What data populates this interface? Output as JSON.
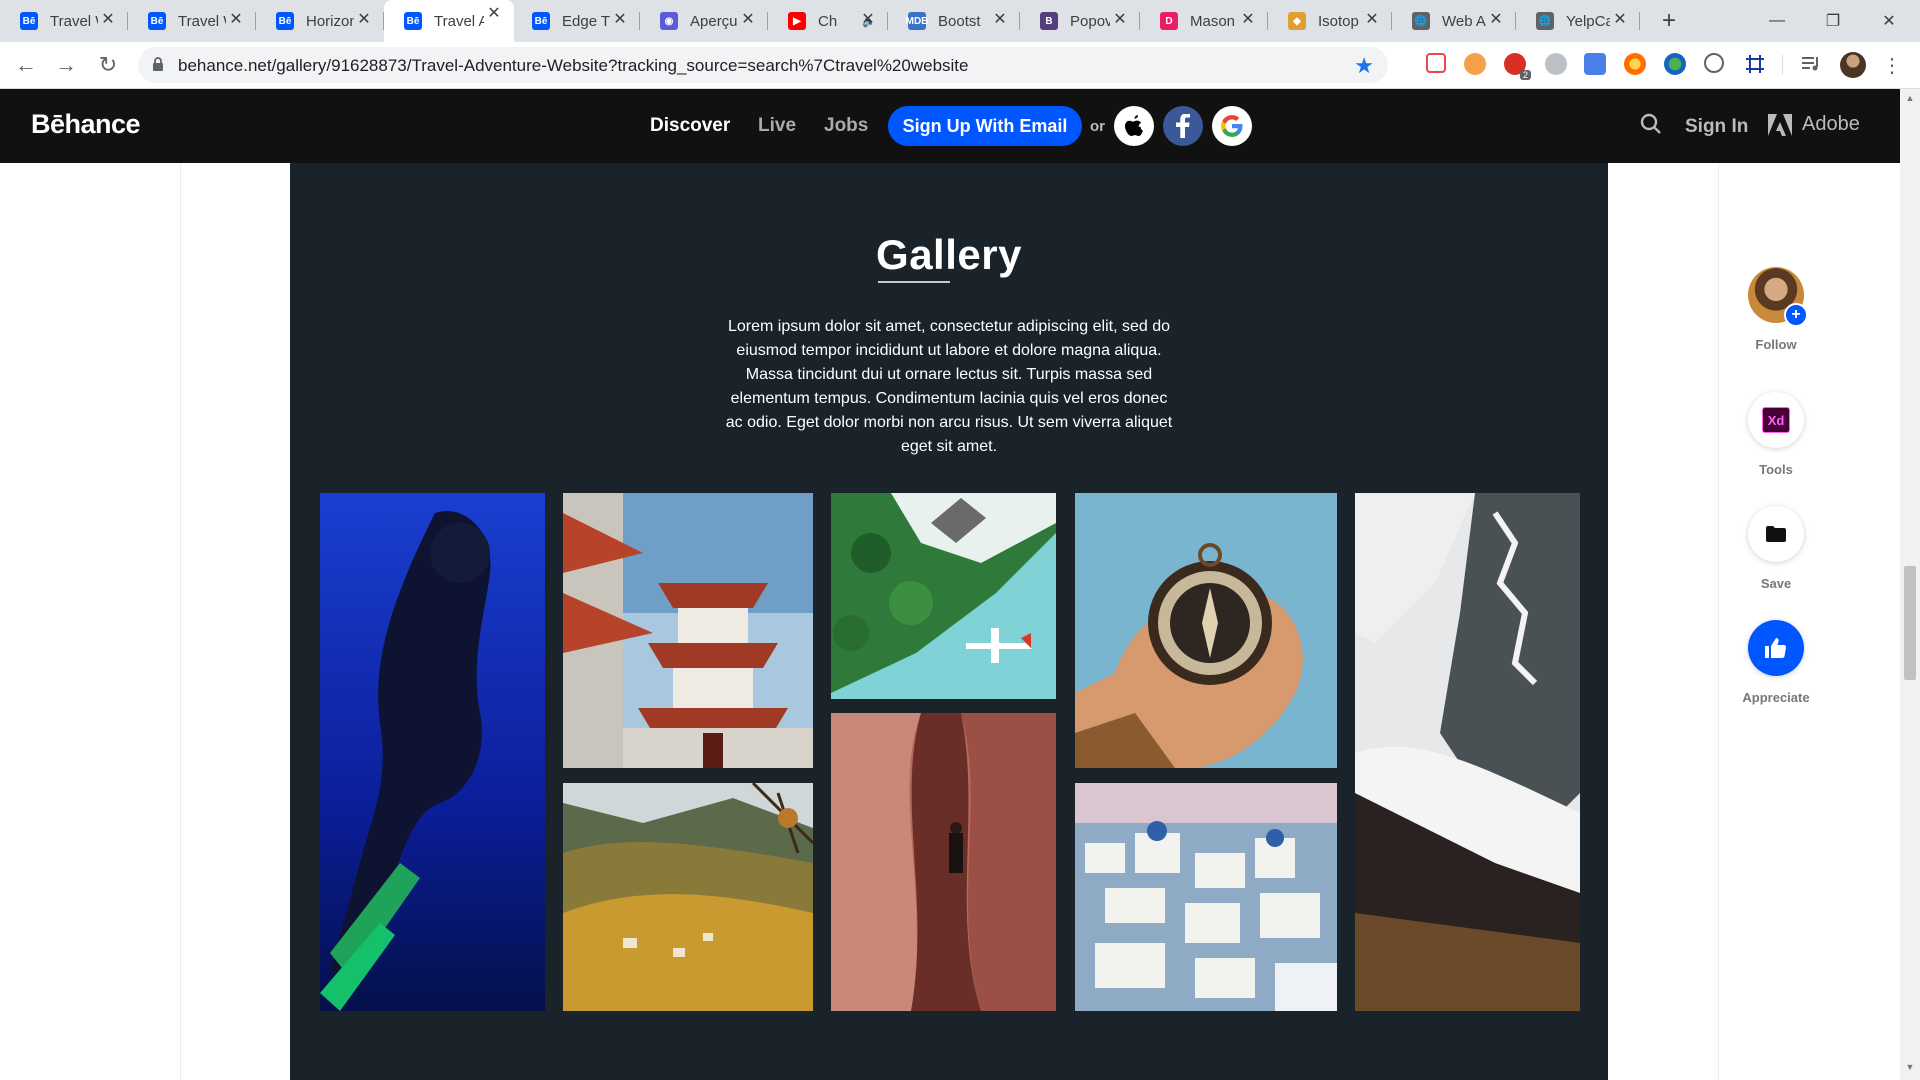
{
  "browser": {
    "tabs": [
      {
        "title": "Travel W",
        "favicon": "Bē",
        "color": "#0057ff"
      },
      {
        "title": "Travel W",
        "favicon": "Bē",
        "color": "#0057ff"
      },
      {
        "title": "Horizon",
        "favicon": "Bē",
        "color": "#0057ff"
      },
      {
        "title": "Travel A",
        "favicon": "Bē",
        "color": "#0057ff",
        "active": true
      },
      {
        "title": "Edge T",
        "favicon": "Bē",
        "color": "#0057ff"
      },
      {
        "title": "Aperçu",
        "favicon": "◉",
        "color": "#5b5bd6"
      },
      {
        "title": "Ch",
        "favicon": "▶",
        "color": "#ff0000",
        "audio": true
      },
      {
        "title": "Bootst",
        "favicon": "MDB",
        "color": "#3b71ca"
      },
      {
        "title": "Popov",
        "favicon": "B",
        "color": "#563d7c"
      },
      {
        "title": "Mason",
        "favicon": "D",
        "color": "#e91e63"
      },
      {
        "title": "Isotop",
        "favicon": "◆",
        "color": "#e0a030"
      },
      {
        "title": "Web A",
        "favicon": "🌐",
        "color": "#5f6368"
      },
      {
        "title": "YelpCa",
        "favicon": "🌐",
        "color": "#5f6368"
      }
    ],
    "url": "behance.net/gallery/91628873/Travel-Adventure-Website?tracking_source=search%7Ctravel%20website",
    "extension_badge": "2"
  },
  "behance_nav": {
    "logo": "Bēhance",
    "links": [
      "Discover",
      "Live",
      "Jobs"
    ],
    "signup_label": "Sign Up With Email",
    "or_label": "or",
    "signin_label": "Sign In",
    "adobe_label": "Adobe"
  },
  "gallery": {
    "title": "Gallery",
    "description": "Lorem ipsum dolor sit amet, consectetur adipiscing elit, sed do eiusmod tempor incididunt ut labore et dolore magna aliqua. Massa tincidunt dui ut ornare lectus sit. Turpis massa sed elementum tempus. Condimentum lacinia quis vel eros donec ac odio. Eget dolor morbi non arcu risus. Ut sem viverra aliquet eget sit amet.",
    "photos": [
      "scuba-diver",
      "pagoda",
      "tropical-island-seaplane",
      "compass-in-hand",
      "snowy-mountain-clouds",
      "alpine-valley-village",
      "red-rock-canyon",
      "santorini-village"
    ]
  },
  "sidebar": {
    "follow_label": "Follow",
    "tools_label": "Tools",
    "tools_icon": "Xd",
    "save_label": "Save",
    "appreciate_label": "Appreciate"
  },
  "colors": {
    "behance_blue": "#0057ff",
    "project_bg": "#1b232a",
    "nav_bg": "#111111"
  }
}
